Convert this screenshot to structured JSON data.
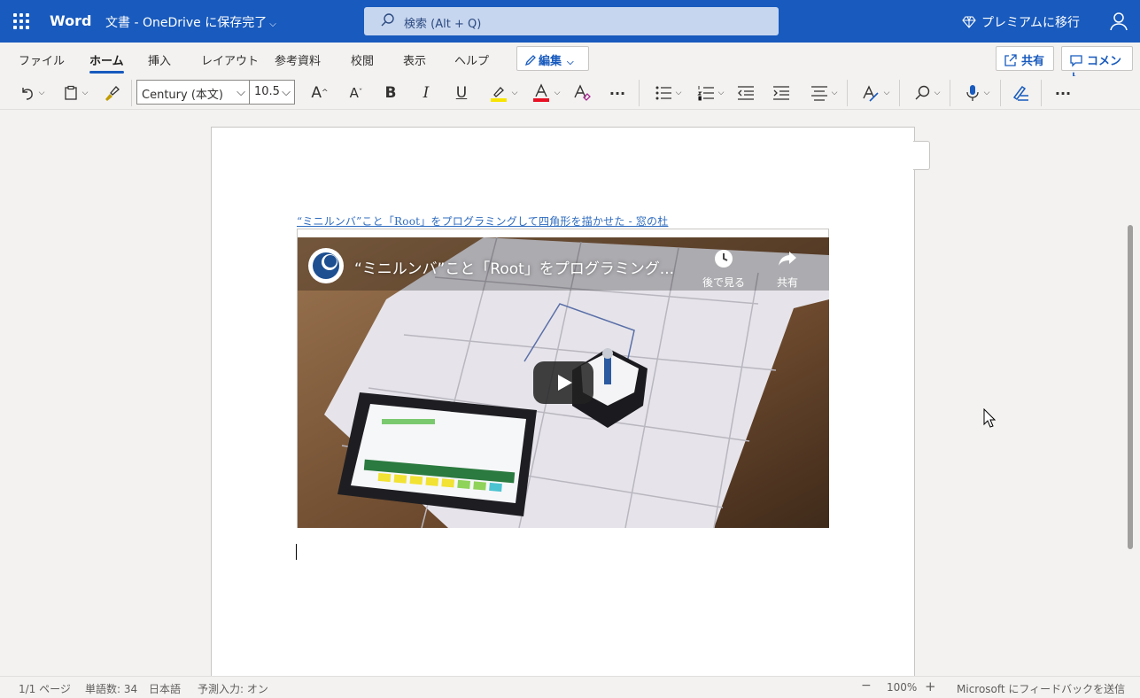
{
  "app": {
    "name": "Word",
    "doc_title": "文書 - OneDrive に保存完了",
    "search_placeholder": "検索 (Alt + Q)",
    "premium": "プレミアムに移行"
  },
  "tabs": [
    {
      "label": "ファイル",
      "active": false
    },
    {
      "label": "ホーム",
      "active": true
    },
    {
      "label": "挿入",
      "active": false
    },
    {
      "label": "レイアウト",
      "active": false
    },
    {
      "label": "参考資料",
      "active": false
    },
    {
      "label": "校閲",
      "active": false
    },
    {
      "label": "表示",
      "active": false
    },
    {
      "label": "ヘルプ",
      "active": false
    }
  ],
  "edit_mode": "編集",
  "share_label": "共有",
  "comment_label": "コメント",
  "toolbar": {
    "font_name": "Century (本文)",
    "font_size": "10.5",
    "bold": "B",
    "italic": "I",
    "underline": "U",
    "grow_font": "A",
    "shrink_font": "A",
    "highlight_color": "#f7e400",
    "font_color": "#e81123"
  },
  "document": {
    "link_text": "“ミニルンバ”こと「Root」をプログラミングして四角形を描かせた - 窓の杜",
    "video": {
      "title": "“ミニルンバ”こと「Root」をプログラミング...",
      "watch_later": "後で見る",
      "share": "共有"
    }
  },
  "status": {
    "page": "1/1 ページ",
    "words": "単語数: 34",
    "language": "日本語",
    "prediction": "予測入力: オン",
    "zoom_minus": "−",
    "zoom": "100%",
    "zoom_plus": "+",
    "feedback": "Microsoft にフィードバックを送信"
  },
  "colors": {
    "brand": "#185abd",
    "link": "#2f6cbf"
  }
}
